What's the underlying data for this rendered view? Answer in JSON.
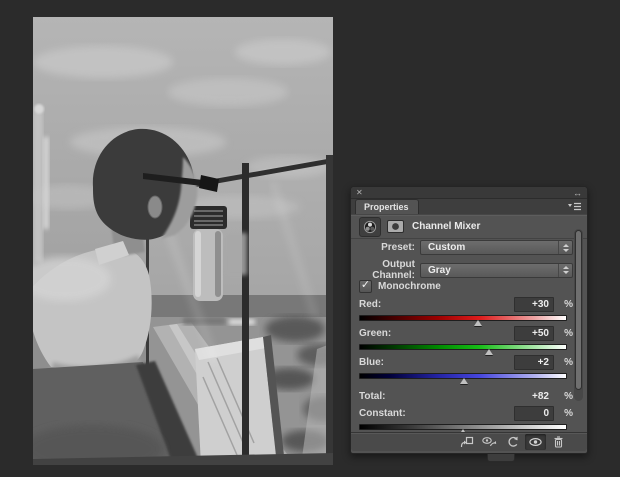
{
  "window": {
    "bg_color": "#2b2b2b"
  },
  "photo": {
    "description": "Grayscale photograph: man with glasses leaning on a ship's glass railing, looking over a harbor and sea under a cloudy sky"
  },
  "panel": {
    "tab_label": "Properties",
    "window_controls": {
      "close_glyph": "✕",
      "collapse_glyph": "↔"
    },
    "header": {
      "title": "Channel Mixer"
    },
    "preset": {
      "label": "Preset:",
      "value": "Custom"
    },
    "output_channel": {
      "label": "Output Channel:",
      "value": "Gray"
    },
    "monochrome": {
      "label": "Monochrome",
      "checked": true,
      "check_glyph": "✓"
    },
    "sliders": [
      {
        "channel": "Red",
        "label": "Red:",
        "value": "+30",
        "unit": "%",
        "thumb_left": "57.5%",
        "color": "#dd1c1c"
      },
      {
        "channel": "Green",
        "label": "Green:",
        "value": "+50",
        "unit": "%",
        "thumb_left": "62.5%",
        "color": "#17bd17"
      },
      {
        "channel": "Blue",
        "label": "Blue:",
        "value": "+2",
        "unit": "%",
        "thumb_left": "50.5%",
        "color": "#4646dd"
      }
    ],
    "total": {
      "label": "Total:",
      "value": "+82",
      "unit": "%"
    },
    "constant": {
      "label": "Constant:",
      "value": "0",
      "unit": "%",
      "thumb_left": "50%"
    },
    "toolbar": {
      "icons": [
        "clip-to-layer",
        "view-previous-state",
        "reset",
        "toggle-visibility",
        "delete"
      ],
      "active_icon": "toggle-visibility"
    }
  }
}
